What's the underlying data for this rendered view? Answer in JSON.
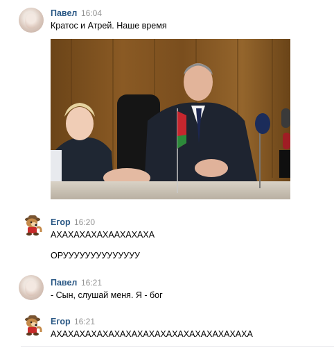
{
  "messages": [
    {
      "author": "Павел",
      "time": "16:04",
      "avatar_icon": "user-avatar-icon",
      "lines": [
        "Кратос и Атрей. Наше время"
      ],
      "has_photo": true
    },
    {
      "author": "Егор",
      "time": "16:20",
      "avatar_icon": "chipmunk-avatar-icon",
      "lines": [
        "АХАХАХАХАХААХАХАХА",
        "ОРУУУУУУУУУУУУУУ"
      ]
    },
    {
      "author": "Павел",
      "time": "16:21",
      "avatar_icon": "user-avatar-icon",
      "lines": [
        "- Сын, слушай меня. Я - бог"
      ]
    },
    {
      "author": "Егор",
      "time": "16:21",
      "avatar_icon": "chipmunk-avatar-icon",
      "lines": [
        "АХАХАХАХАХАХАХАХАХАХАХАХАХАХАХАХАХА"
      ]
    }
  ],
  "colors": {
    "author_name": "#2a5885",
    "timestamp": "#939393",
    "divider": "#e7e8ec"
  }
}
